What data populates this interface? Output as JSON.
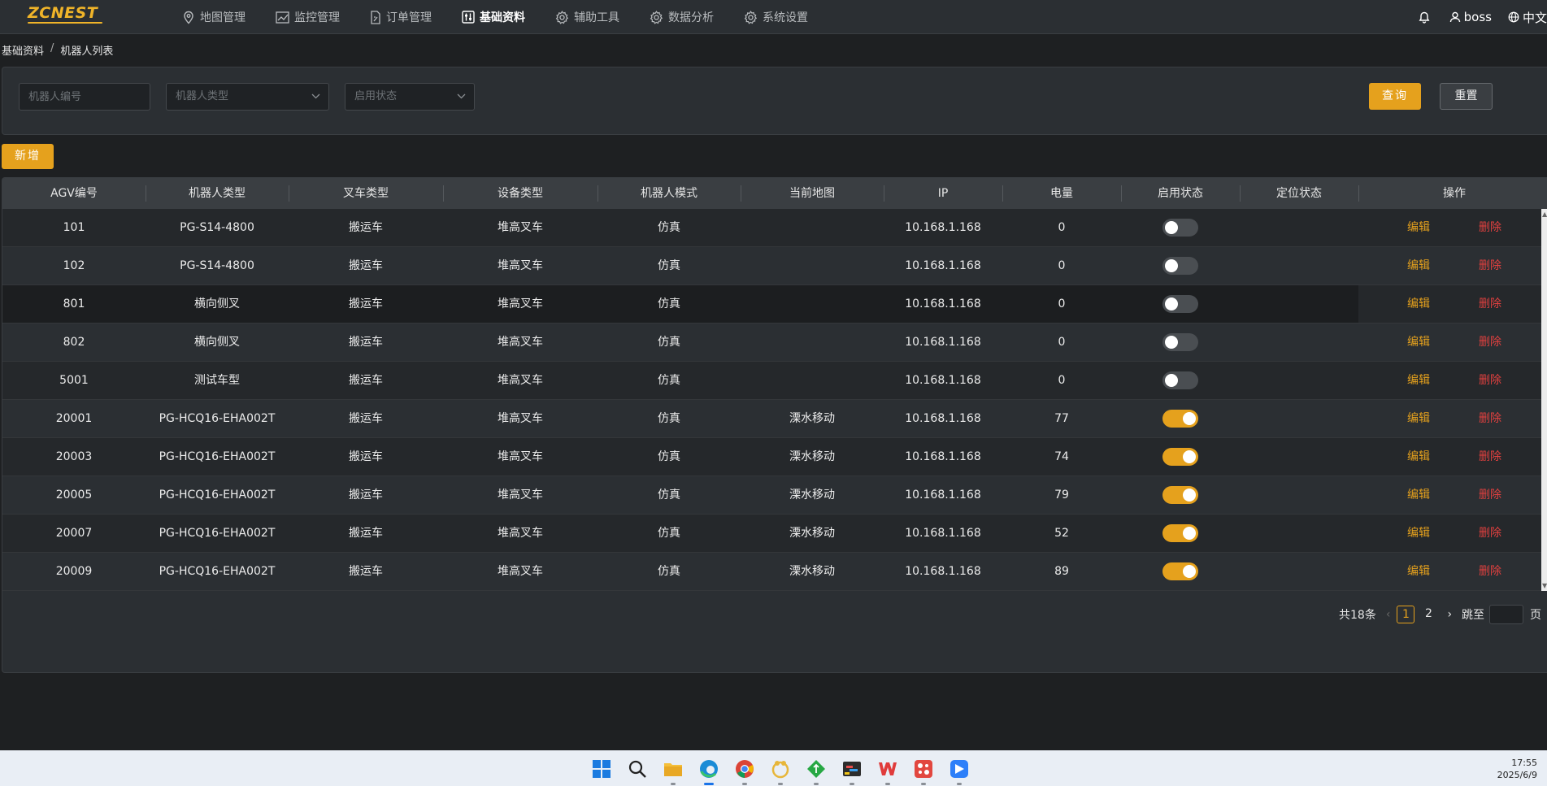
{
  "app": {
    "logo_text": "ZCNEST",
    "brand_color": "#e5a11d"
  },
  "nav": {
    "items": [
      {
        "label": "地图管理",
        "icon": "map-pin-icon"
      },
      {
        "label": "监控管理",
        "icon": "chart-icon"
      },
      {
        "label": "订单管理",
        "icon": "document-icon"
      },
      {
        "label": "基础资料",
        "icon": "sliders-icon",
        "active": true
      },
      {
        "label": "辅助工具",
        "icon": "gear-icon"
      },
      {
        "label": "数据分析",
        "icon": "gear-icon"
      },
      {
        "label": "系统设置",
        "icon": "gear-icon"
      }
    ],
    "user": "boss",
    "language": "中文"
  },
  "breadcrumb": {
    "parent": "基础资料",
    "separator": "/",
    "current": "机器人列表"
  },
  "filters": {
    "robot_id_placeholder": "机器人编号",
    "robot_type_placeholder": "机器人类型",
    "status_placeholder": "启用状态",
    "query_label": "查询",
    "reset_label": "重置"
  },
  "actions": {
    "add_label": "新增"
  },
  "table": {
    "columns": [
      "AGV编号",
      "机器人类型",
      "叉车类型",
      "设备类型",
      "机器人模式",
      "当前地图",
      "IP",
      "电量",
      "启用状态",
      "定位状态",
      "操作"
    ],
    "edit_label": "编辑",
    "delete_label": "删除",
    "rows": [
      {
        "agv": "101",
        "robot_type": "PG-S14-4800",
        "forklift_type": "搬运车",
        "device_type": "堆高叉车",
        "mode": "仿真",
        "map": "",
        "ip": "10.168.1.168",
        "battery": "0",
        "enabled": false,
        "locate": ""
      },
      {
        "agv": "102",
        "robot_type": "PG-S14-4800",
        "forklift_type": "搬运车",
        "device_type": "堆高叉车",
        "mode": "仿真",
        "map": "",
        "ip": "10.168.1.168",
        "battery": "0",
        "enabled": false,
        "locate": ""
      },
      {
        "agv": "801",
        "robot_type": "横向侧叉",
        "forklift_type": "搬运车",
        "device_type": "堆高叉车",
        "mode": "仿真",
        "map": "",
        "ip": "10.168.1.168",
        "battery": "0",
        "enabled": false,
        "locate": ""
      },
      {
        "agv": "802",
        "robot_type": "横向侧叉",
        "forklift_type": "搬运车",
        "device_type": "堆高叉车",
        "mode": "仿真",
        "map": "",
        "ip": "10.168.1.168",
        "battery": "0",
        "enabled": false,
        "locate": ""
      },
      {
        "agv": "5001",
        "robot_type": "测试车型",
        "forklift_type": "搬运车",
        "device_type": "堆高叉车",
        "mode": "仿真",
        "map": "",
        "ip": "10.168.1.168",
        "battery": "0",
        "enabled": false,
        "locate": ""
      },
      {
        "agv": "20001",
        "robot_type": "PG-HCQ16-EHA002T",
        "forklift_type": "搬运车",
        "device_type": "堆高叉车",
        "mode": "仿真",
        "map": "溧水移动",
        "ip": "10.168.1.168",
        "battery": "77",
        "enabled": true,
        "locate": ""
      },
      {
        "agv": "20003",
        "robot_type": "PG-HCQ16-EHA002T",
        "forklift_type": "搬运车",
        "device_type": "堆高叉车",
        "mode": "仿真",
        "map": "溧水移动",
        "ip": "10.168.1.168",
        "battery": "74",
        "enabled": true,
        "locate": ""
      },
      {
        "agv": "20005",
        "robot_type": "PG-HCQ16-EHA002T",
        "forklift_type": "搬运车",
        "device_type": "堆高叉车",
        "mode": "仿真",
        "map": "溧水移动",
        "ip": "10.168.1.168",
        "battery": "79",
        "enabled": true,
        "locate": ""
      },
      {
        "agv": "20007",
        "robot_type": "PG-HCQ16-EHA002T",
        "forklift_type": "搬运车",
        "device_type": "堆高叉车",
        "mode": "仿真",
        "map": "溧水移动",
        "ip": "10.168.1.168",
        "battery": "52",
        "enabled": true,
        "locate": ""
      },
      {
        "agv": "20009",
        "robot_type": "PG-HCQ16-EHA002T",
        "forklift_type": "搬运车",
        "device_type": "堆高叉车",
        "mode": "仿真",
        "map": "溧水移动",
        "ip": "10.168.1.168",
        "battery": "89",
        "enabled": true,
        "locate": ""
      }
    ]
  },
  "pagination": {
    "total_text": "共18条",
    "pages": [
      "1",
      "2"
    ],
    "current_page": "1",
    "goto_label": "跳至",
    "page_suffix": "页"
  },
  "taskbar": {
    "apps": [
      "windows-start-icon",
      "search-icon",
      "file-explorer-icon",
      "edge-icon",
      "chrome-icon",
      "app-icon",
      "app-icon",
      "app-icon",
      "wps-icon",
      "app-icon",
      "app-icon"
    ],
    "time": "17:55",
    "date": "2025/6/9"
  }
}
